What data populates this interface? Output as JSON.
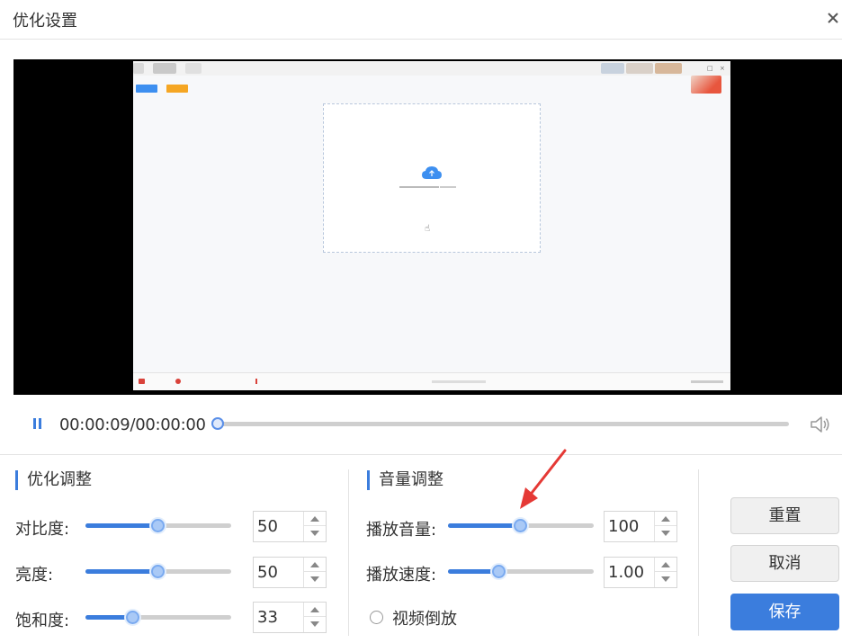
{
  "window": {
    "title": "优化设置"
  },
  "player": {
    "time": "00:00:09/00:00:00",
    "progress": 0
  },
  "optimize": {
    "title": "优化调整",
    "contrast": {
      "label": "对比度:",
      "value": "50",
      "level": 50
    },
    "brightness": {
      "label": "亮度:",
      "value": "50",
      "level": 50
    },
    "saturation": {
      "label": "饱和度:",
      "value": "33",
      "level": 33
    }
  },
  "volume": {
    "title": "音量调整",
    "play_volume": {
      "label": "播放音量:",
      "value": "100",
      "level": 50
    },
    "play_speed": {
      "label": "播放速度:",
      "value": "1.00",
      "level": 35
    },
    "reverse_label": "视频倒放"
  },
  "buttons": {
    "reset": "重置",
    "cancel": "取消",
    "save": "保存"
  },
  "colors": {
    "accent": "#3b7ddd",
    "annotation_arrow": "#e53935"
  }
}
